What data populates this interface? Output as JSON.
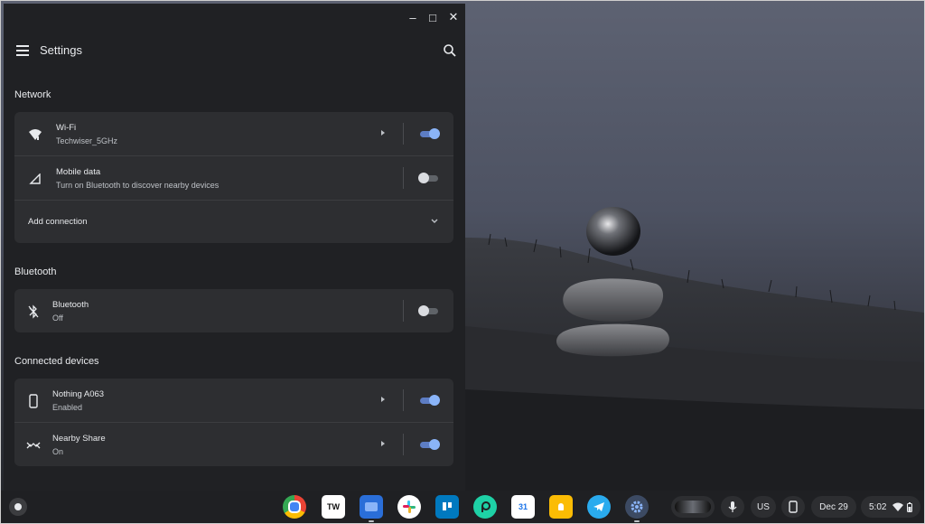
{
  "window": {
    "title": "Settings",
    "controls": {
      "minimize": "–",
      "maximize": "□",
      "close": "✕"
    }
  },
  "sections": {
    "network": {
      "title": "Network",
      "wifi": {
        "label": "Wi-Fi",
        "sub": "Techwiser_5GHz",
        "enabled": true
      },
      "mobile": {
        "label": "Mobile data",
        "sub": "Turn on Bluetooth to discover nearby devices",
        "enabled": false
      },
      "add_connection": {
        "label": "Add connection"
      }
    },
    "bluetooth": {
      "title": "Bluetooth",
      "bt": {
        "label": "Bluetooth",
        "sub": "Off",
        "enabled": false
      }
    },
    "connected": {
      "title": "Connected devices",
      "phone": {
        "label": "Nothing A063",
        "sub": "Enabled",
        "enabled": true
      },
      "nearby": {
        "label": "Nearby Share",
        "sub": "On",
        "enabled": true
      }
    }
  },
  "shelf": {
    "apps": [
      {
        "name": "chrome-icon"
      },
      {
        "name": "techwiser-icon",
        "text": "TW"
      },
      {
        "name": "files-icon"
      },
      {
        "name": "slack-icon"
      },
      {
        "name": "trello-icon"
      },
      {
        "name": "picsart-icon"
      },
      {
        "name": "calendar-icon",
        "text": "31"
      },
      {
        "name": "keep-icon"
      },
      {
        "name": "telegram-icon"
      },
      {
        "name": "settings-icon"
      }
    ],
    "ime": "US",
    "date": "Dec 29",
    "time": "5:02"
  },
  "colors": {
    "accent": "#8ab4f8",
    "panel": "#202124",
    "card": "#2d2e31",
    "shelf": "#1f2023"
  }
}
